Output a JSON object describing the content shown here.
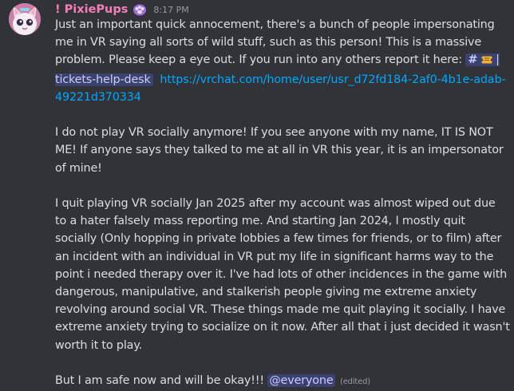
{
  "author": {
    "name": "! PixiePups",
    "role_icon": "purple-cat-paw-icon",
    "timestamp": "8:17 PM",
    "name_color": "#f47fb4"
  },
  "message": {
    "p1_intro": "Just an important quick annocement, there's a bunch of people impersonating me in VR saying all sorts of wild stuff, such as this person! This is a massive problem. Please keep a eye out. If you run into any others report it here: ",
    "channel_hash": "#",
    "channel_icon": "ticket-icon",
    "channel_name": " | tickets-help-desk",
    "link_url": "https://vrchat.com/home/user/usr_d72fd184-2af0-4b1e-adab-49221d370334",
    "p2": "I do not play VR socially anymore! If you see anyone with my name, IT IS NOT ME! If anyone says they talked to me at all in VR this year, it is an impersonator of mine!",
    "p3": "I quit playing VR socially Jan 2025 after my account was almost wiped out due to a hater falsely mass reporting me. And starting Jan 2024, I mostly quit socially (Only hopping in private lobbies a few times for friends, or to film) after an incident with an individual in VR put my life in significant harms way to the point i needed therapy over it. I've had lots of other incidences in the game with dangerous, manipulative, and stalkerish people giving me extreme anxiety revolving around social VR. These things made me quit playing it socially. I have extreme anxiety trying to socialize on it now. After all that i just decided it wasn't worth it to play.",
    "p4_text": "But I am safe now and will be okay!!! ",
    "mention": "@everyone",
    "edited": "(edited)"
  },
  "colors": {
    "background": "#323339",
    "text": "#dbdee1",
    "link": "#00a8fc",
    "mention_bg": "#3c4270",
    "mention_text": "#c9cdfb",
    "muted": "#949ba4"
  }
}
